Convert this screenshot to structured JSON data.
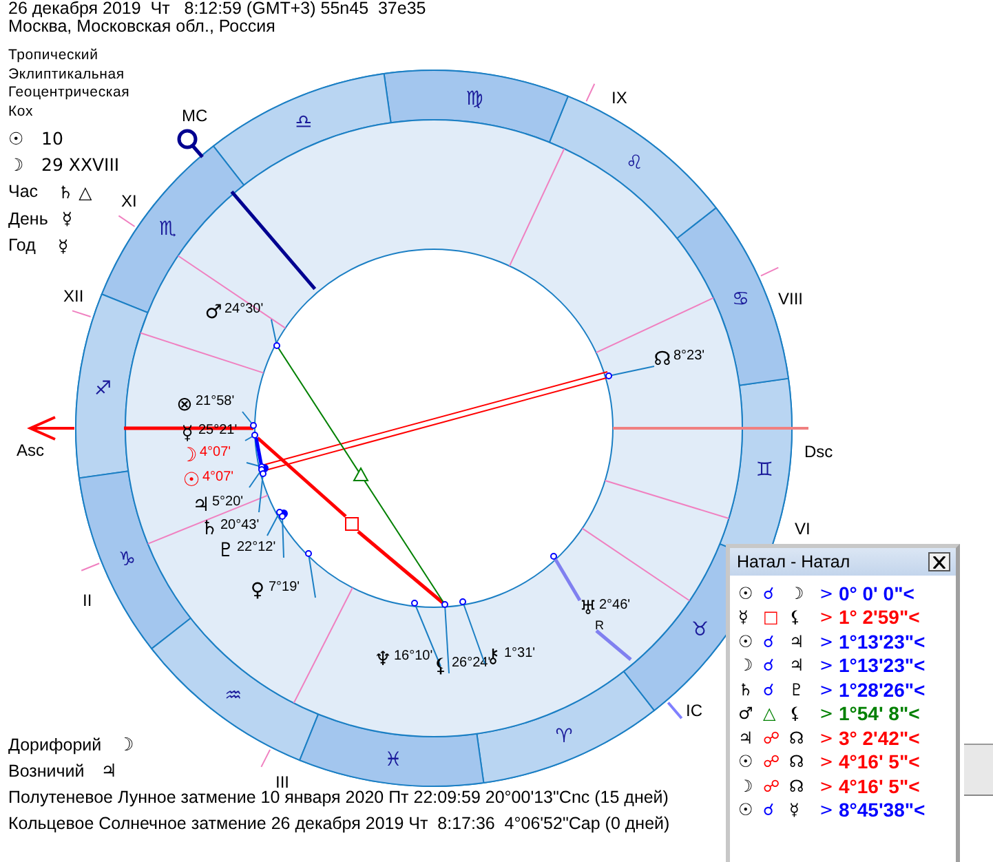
{
  "header": {
    "date_line": "26 декабря 2019  Чт   8:12:59 (GMT+3) 55n45  37e35",
    "place": "Москва, Московская обл., Россия"
  },
  "settings": [
    "Тропический",
    "Эклиптикальная",
    "Геоцентрическая",
    "Кох"
  ],
  "info": [
    {
      "label": "☉",
      "value": "10"
    },
    {
      "label": "☽",
      "value": "29 XXVIII"
    },
    {
      "label": "Час",
      "value": "♄ △"
    },
    {
      "label": "День",
      "value": "☿"
    },
    {
      "label": "Год",
      "value": "☿"
    }
  ],
  "zodiac": [
    "♈",
    "♉",
    "♊",
    "♋",
    "♌",
    "♍",
    "♎",
    "♏",
    "♐",
    "♑",
    "♒",
    "♓"
  ],
  "houses": [
    "Asc",
    "II",
    "III",
    "IC",
    "VI",
    "Dsc",
    "VIII",
    "IX",
    "MC",
    "XI",
    "XII"
  ],
  "planets": [
    {
      "glyph": "♂",
      "position": "24°30'",
      "color": "#000000"
    },
    {
      "glyph": "⊗",
      "position": "21°58'",
      "color": "#000000"
    },
    {
      "glyph": "☿",
      "position": "25°21'",
      "color": "#000000"
    },
    {
      "glyph": "☽",
      "position": "4°07'",
      "color": "#ff0000"
    },
    {
      "glyph": "☉",
      "position": "4°07'",
      "color": "#ff0000"
    },
    {
      "glyph": "♃",
      "position": "5°20'",
      "color": "#000000"
    },
    {
      "glyph": "♄",
      "position": "20°43'",
      "color": "#000000"
    },
    {
      "glyph": "♇",
      "position": "22°12'",
      "color": "#000000"
    },
    {
      "glyph": "♀",
      "position": "7°19'",
      "color": "#000000"
    },
    {
      "glyph": "♆",
      "position": "16°10'",
      "color": "#000000"
    },
    {
      "glyph": "⚸",
      "position": "26°24'",
      "color": "#000000"
    },
    {
      "glyph": "⚷",
      "position": "1°31'",
      "color": "#000000"
    },
    {
      "glyph": "♅",
      "position": "2°46'",
      "color": "#000000",
      "retrograde": "R"
    },
    {
      "glyph": "☊",
      "position": "8°23'",
      "color": "#000000"
    }
  ],
  "fixed_stars": [
    {
      "name": "Дорифорий",
      "glyph": "☽"
    },
    {
      "name": "Возничий",
      "glyph": "♃"
    }
  ],
  "eclipses": [
    "Полутеневое Лунное затмение 10 января 2020 Пт 22:09:59 20°00'13\"Cnc (15 дней)",
    "Кольцевое Солнечное затмение 26 декабря 2019 Чт  8:17:36  4°06'52\"Cap (0 дней)"
  ],
  "aspect_table": {
    "title": "Натал - Натал",
    "rows": [
      {
        "planet_1": "☉",
        "aspect": "☌",
        "planet_2": "☽",
        "arrow": ">",
        "orb": "0° 0' 0\"<",
        "color": "#0000ff"
      },
      {
        "planet_1": "☿",
        "aspect": "□",
        "planet_2": "⚸",
        "arrow": ">",
        "orb": "1° 2'59\"<",
        "color": "#ff0000"
      },
      {
        "planet_1": "☉",
        "aspect": "☌",
        "planet_2": "♃",
        "arrow": ">",
        "orb": "1°13'23\"<",
        "color": "#0000ff"
      },
      {
        "planet_1": "☽",
        "aspect": "☌",
        "planet_2": "♃",
        "arrow": ">",
        "orb": "1°13'23\"<",
        "color": "#0000ff"
      },
      {
        "planet_1": "♄",
        "aspect": "☌",
        "planet_2": "♇",
        "arrow": ">",
        "orb": "1°28'26\"<",
        "color": "#0000ff"
      },
      {
        "planet_1": "♂",
        "aspect": "△",
        "planet_2": "⚸",
        "arrow": ">",
        "orb": "1°54' 8\"<",
        "color": "#008000"
      },
      {
        "planet_1": "♃",
        "aspect": "☍",
        "planet_2": "☊",
        "arrow": ">",
        "orb": "3° 2'42\"<",
        "color": "#ff0000"
      },
      {
        "planet_1": "☉",
        "aspect": "☍",
        "planet_2": "☊",
        "arrow": ">",
        "orb": "4°16' 5\"<",
        "color": "#ff0000"
      },
      {
        "planet_1": "☽",
        "aspect": "☍",
        "planet_2": "☊",
        "arrow": ">",
        "orb": "4°16' 5\"<",
        "color": "#ff0000"
      },
      {
        "planet_1": "☉",
        "aspect": "☌",
        "planet_2": "☿",
        "arrow": ">",
        "orb": "8°45'38\"<",
        "color": "#0000ff"
      }
    ]
  }
}
